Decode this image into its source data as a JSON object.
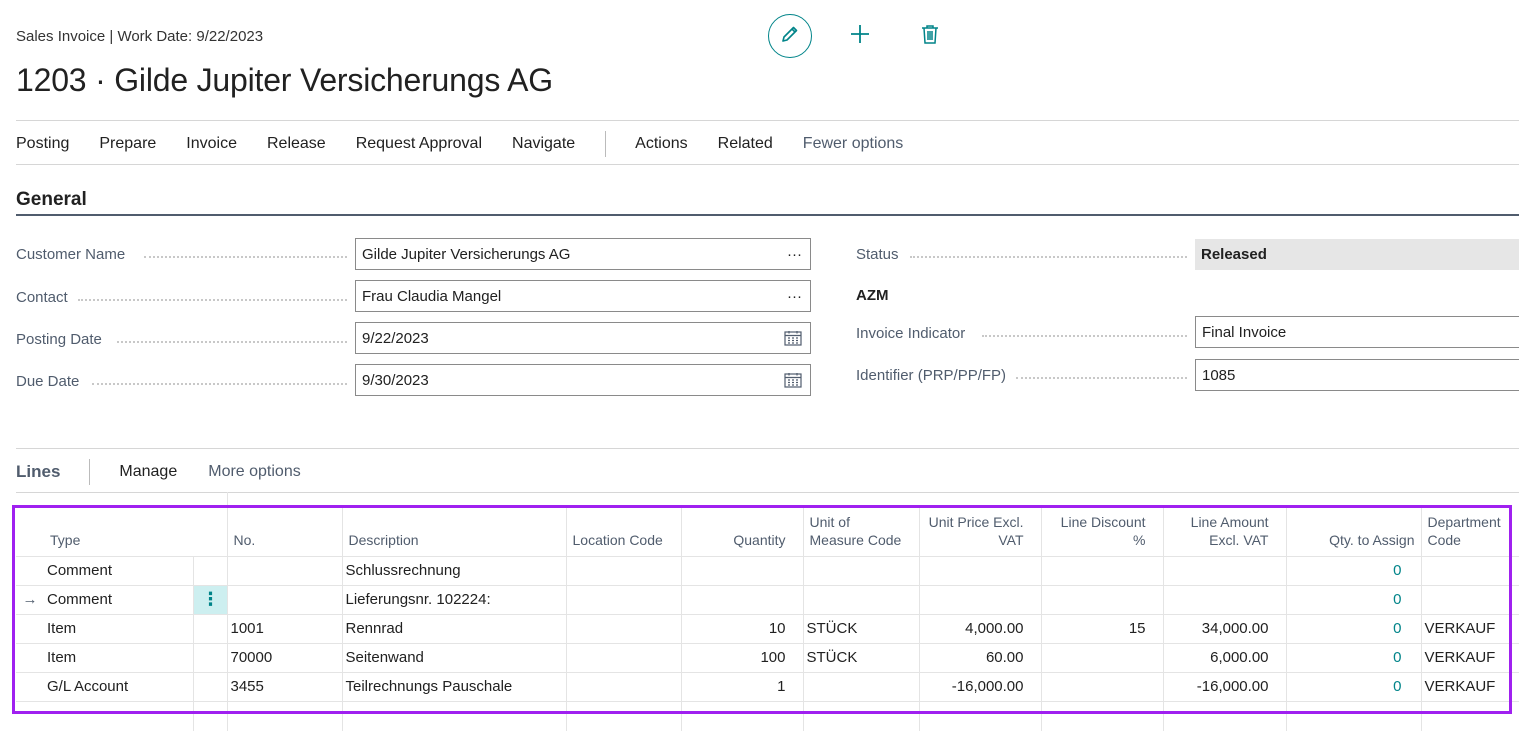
{
  "header": {
    "caption": "Sales Invoice | Work Date: 9/22/2023",
    "title": "1203 · Gilde Jupiter Versicherungs AG"
  },
  "top_actions": {
    "edit_icon": "pencil-icon",
    "new_icon": "plus-icon",
    "delete_icon": "trash-icon"
  },
  "actionbar": {
    "items": [
      "Posting",
      "Prepare",
      "Invoice",
      "Release",
      "Request Approval",
      "Navigate"
    ],
    "items2": [
      "Actions",
      "Related"
    ],
    "fewer": "Fewer options"
  },
  "general": {
    "title": "General",
    "customer_name": {
      "label": "Customer Name",
      "value": "Gilde Jupiter Versicherungs AG"
    },
    "contact": {
      "label": "Contact",
      "value": "Frau Claudia Mangel"
    },
    "posting_date": {
      "label": "Posting Date",
      "value": "9/22/2023"
    },
    "due_date": {
      "label": "Due Date",
      "value": "9/30/2023"
    },
    "status": {
      "label": "Status",
      "value": "Released"
    },
    "azm": "AZM",
    "invoice_indicator": {
      "label": "Invoice Indicator",
      "value": "Final Invoice"
    },
    "identifier": {
      "label": "Identifier (PRP/PP/FP)",
      "value": "1085"
    },
    "ellipsis": "···"
  },
  "lines": {
    "title": "Lines",
    "manage": "Manage",
    "more": "More options",
    "columns": {
      "type": "Type",
      "no": "No.",
      "description": "Description",
      "location": "Location Code",
      "quantity": "Quantity",
      "uom_1": "Unit of",
      "uom_2": "Measure Code",
      "price_1": "Unit Price Excl.",
      "price_2": "VAT",
      "discount_1": "Line Discount",
      "discount_2": "%",
      "amount_1": "Line Amount",
      "amount_2": "Excl. VAT",
      "qty_assign": "Qty. to Assign",
      "dept_1": "Department",
      "dept_2": "Code"
    },
    "rows": [
      {
        "type": "Comment",
        "no": "",
        "description": "Schlussrechnung",
        "location": "",
        "quantity": "",
        "uom": "",
        "price": "",
        "discount": "",
        "amount": "",
        "qty_assign": "0",
        "dept": ""
      },
      {
        "type": "Comment",
        "no": "",
        "description": "Lieferungsnr. 102224:",
        "location": "",
        "quantity": "",
        "uom": "",
        "price": "",
        "discount": "",
        "amount": "",
        "qty_assign": "0",
        "dept": "",
        "current": true
      },
      {
        "type": "Item",
        "no": "1001",
        "description": "Rennrad",
        "location": "",
        "quantity": "10",
        "uom": "STÜCK",
        "price": "4,000.00",
        "discount": "15",
        "amount": "34,000.00",
        "qty_assign": "0",
        "dept": "VERKAUF"
      },
      {
        "type": "Item",
        "no": "70000",
        "description": "Seitenwand",
        "location": "",
        "quantity": "100",
        "uom": "STÜCK",
        "price": "60.00",
        "discount": "",
        "amount": "6,000.00",
        "qty_assign": "0",
        "dept": "VERKAUF"
      },
      {
        "type": "G/L Account",
        "no": "3455",
        "description": "Teilrechnungs Pauschale",
        "location": "",
        "quantity": "1",
        "uom": "",
        "price": "-16,000.00",
        "discount": "",
        "amount": "-16,000.00",
        "qty_assign": "0",
        "dept": "VERKAUF"
      }
    ],
    "current_row_marker": "→",
    "row_menu": "⋮"
  },
  "colors": {
    "accent": "#008489",
    "highlight": "#a020f0"
  }
}
